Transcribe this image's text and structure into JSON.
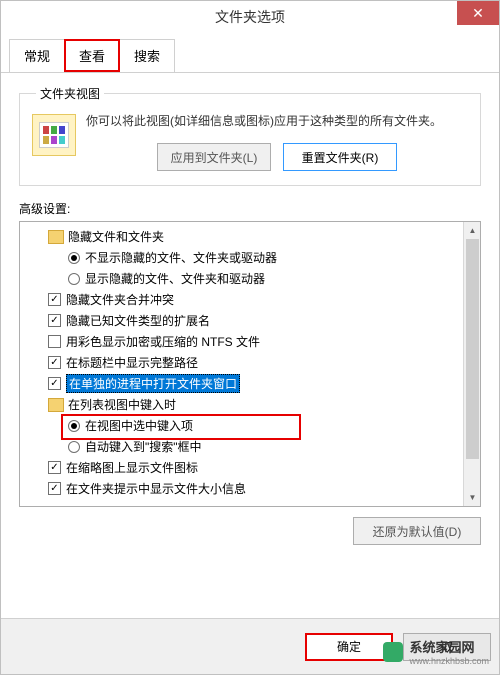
{
  "titlebar": {
    "title": "文件夹选项"
  },
  "tabs": {
    "general": "常规",
    "view": "查看",
    "search": "搜索"
  },
  "folderView": {
    "legend": "文件夹视图",
    "desc": "你可以将此视图(如详细信息或图标)应用于这种类型的所有文件夹。",
    "applyBtn": "应用到文件夹(L)",
    "resetBtn": "重置文件夹(R)"
  },
  "advanced": {
    "label": "高级设置:",
    "items": [
      {
        "type": "folder",
        "indent": 1,
        "text": "隐藏文件和文件夹"
      },
      {
        "type": "radio",
        "indent": 2,
        "selected": true,
        "text": "不显示隐藏的文件、文件夹或驱动器"
      },
      {
        "type": "radio",
        "indent": 2,
        "selected": false,
        "text": "显示隐藏的文件、文件夹和驱动器"
      },
      {
        "type": "check",
        "indent": 1,
        "checked": true,
        "text": "隐藏文件夹合并冲突"
      },
      {
        "type": "check",
        "indent": 1,
        "checked": true,
        "text": "隐藏已知文件类型的扩展名"
      },
      {
        "type": "check",
        "indent": 1,
        "checked": false,
        "text": "用彩色显示加密或压缩的 NTFS 文件"
      },
      {
        "type": "check",
        "indent": 1,
        "checked": true,
        "text": "在标题栏中显示完整路径"
      },
      {
        "type": "check",
        "indent": 1,
        "checked": true,
        "highlighted": true,
        "text": "在单独的进程中打开文件夹窗口"
      },
      {
        "type": "folder",
        "indent": 1,
        "text": "在列表视图中键入时"
      },
      {
        "type": "radio",
        "indent": 2,
        "selected": true,
        "text": "在视图中选中键入项"
      },
      {
        "type": "radio",
        "indent": 2,
        "selected": false,
        "text": "自动键入到\"搜索\"框中"
      },
      {
        "type": "check",
        "indent": 1,
        "checked": true,
        "text": "在缩略图上显示文件图标"
      },
      {
        "type": "check",
        "indent": 1,
        "checked": true,
        "text": "在文件夹提示中显示文件大小信息"
      }
    ],
    "restoreBtn": "还原为默认值(D)"
  },
  "buttons": {
    "ok": "确定",
    "cancel": "取"
  },
  "watermark": {
    "text": "系统家园网",
    "url": "www.hnzkhbsb.com"
  }
}
